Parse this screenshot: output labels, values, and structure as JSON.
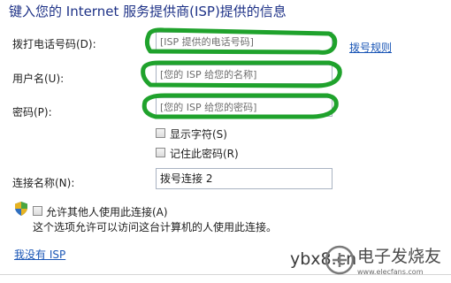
{
  "header": {
    "title": "键入您的 Internet 服务提供商(ISP)提供的信息"
  },
  "form": {
    "phone": {
      "label": "拨打电话号码(D):",
      "placeholder": "[ISP 提供的电话号码]"
    },
    "dialing_rules_link": "拨号规则",
    "username": {
      "label": "用户名(U):",
      "placeholder": "[您的 ISP 给您的名称]"
    },
    "password": {
      "label": "密码(P):",
      "placeholder": "[您的 ISP 给您的密码]"
    },
    "show_chars": {
      "label": "显示字符(S)",
      "checked": false
    },
    "remember_pw": {
      "label": "记住此密码(R)",
      "checked": false
    },
    "connection_name": {
      "label": "连接名称(N):",
      "value": "拨号连接 2"
    },
    "allow_others": {
      "label": "允许其他人使用此连接(A)",
      "note": "这个选项允许可以访问这台计算机的人使用此连接。",
      "checked": false
    },
    "no_isp_link": "我没有 ISP"
  },
  "watermark": {
    "left": "ybx8.cn",
    "logo_text": "电子发烧友",
    "logo_url": "www.elecfans.com"
  },
  "annotation_color": "#1fa22c"
}
